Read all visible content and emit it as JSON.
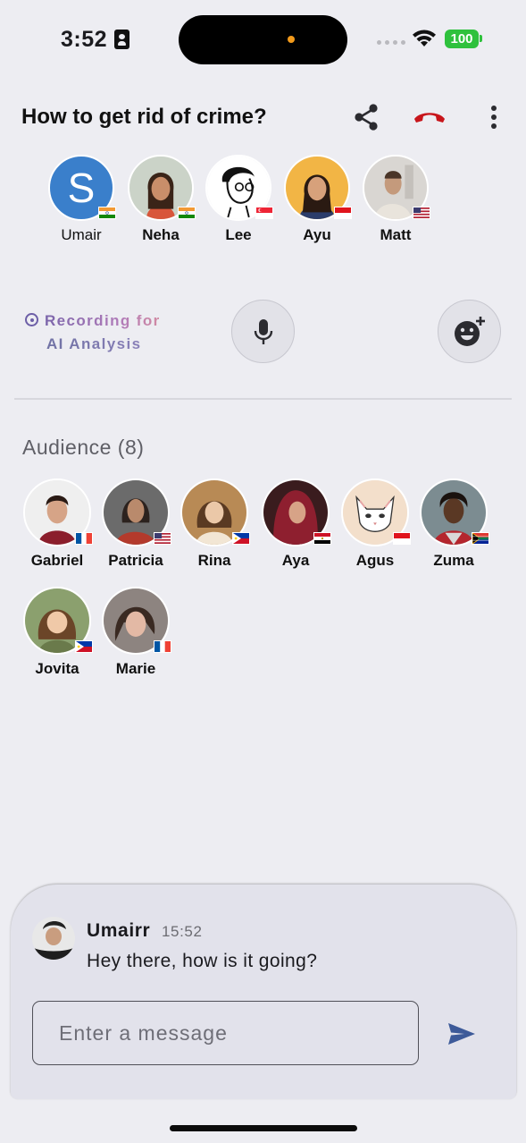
{
  "status_bar": {
    "time": "3:52",
    "battery": "100"
  },
  "header": {
    "title": "How to get rid of crime?",
    "share_icon": "share-icon",
    "hangup_icon": "phone-hangup-icon",
    "more_icon": "more-vertical-icon"
  },
  "speakers": [
    {
      "name": "Umair",
      "flag": "india",
      "initial": "S",
      "host": true
    },
    {
      "name": "Neha",
      "flag": "india"
    },
    {
      "name": "Lee",
      "flag": "singapore"
    },
    {
      "name": "Ayu",
      "flag": "indonesia"
    },
    {
      "name": "Matt",
      "flag": "usa"
    }
  ],
  "recording": {
    "line1": "Recording for",
    "line2": "AI Analysis"
  },
  "controls": {
    "mic_icon": "microphone-icon",
    "emoji_icon": "add-reaction-icon"
  },
  "audience": {
    "title": "Audience (8)",
    "members": [
      {
        "name": "Gabriel",
        "flag": "france"
      },
      {
        "name": "Patricia",
        "flag": "usa"
      },
      {
        "name": "Rina",
        "flag": "philippines"
      },
      {
        "name": "Aya",
        "flag": "egypt"
      },
      {
        "name": "Agus",
        "flag": "indonesia"
      },
      {
        "name": "Zuma",
        "flag": "south-africa"
      },
      {
        "name": "Jovita",
        "flag": "philippines"
      },
      {
        "name": "Marie",
        "flag": "france"
      }
    ]
  },
  "chat": {
    "username": "Umairr",
    "time": "15:52",
    "message": "Hey there, how is it going?",
    "input_placeholder": "Enter a message",
    "input_value": "",
    "send_icon": "send-icon"
  },
  "colors": {
    "background": "#EDEDF2",
    "host_avatar": "#3A7FCB",
    "hangup": "#C8151B",
    "send": "#3D5A99",
    "battery": "#2FC13D",
    "chat_panel": "#E2E2EB"
  }
}
